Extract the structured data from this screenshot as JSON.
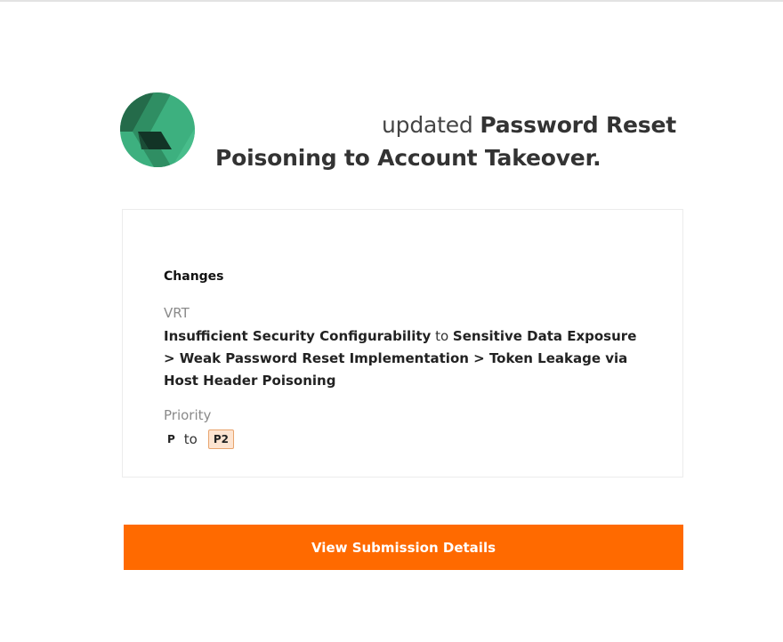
{
  "header": {
    "actor": "",
    "verb": "updated",
    "submission_title": "Password Reset Poisoning to Account Takeover."
  },
  "changes": {
    "heading": "Changes",
    "vrt": {
      "label": "VRT",
      "from": "Insufficient Security Configurability",
      "connector": "to",
      "to": "Sensitive Data Exposure > Weak Password Reset Implementation > Token Leakage via Host Header Poisoning"
    },
    "priority": {
      "label": "Priority",
      "from": "P",
      "connector": "to",
      "to": "P2"
    }
  },
  "cta": {
    "label": "View Submission Details"
  },
  "colors": {
    "accent": "#ff6a00",
    "logo_green": "#3db07f",
    "logo_dark": "#1f5a3f",
    "priority_badge_bg": "#fde4d1"
  }
}
